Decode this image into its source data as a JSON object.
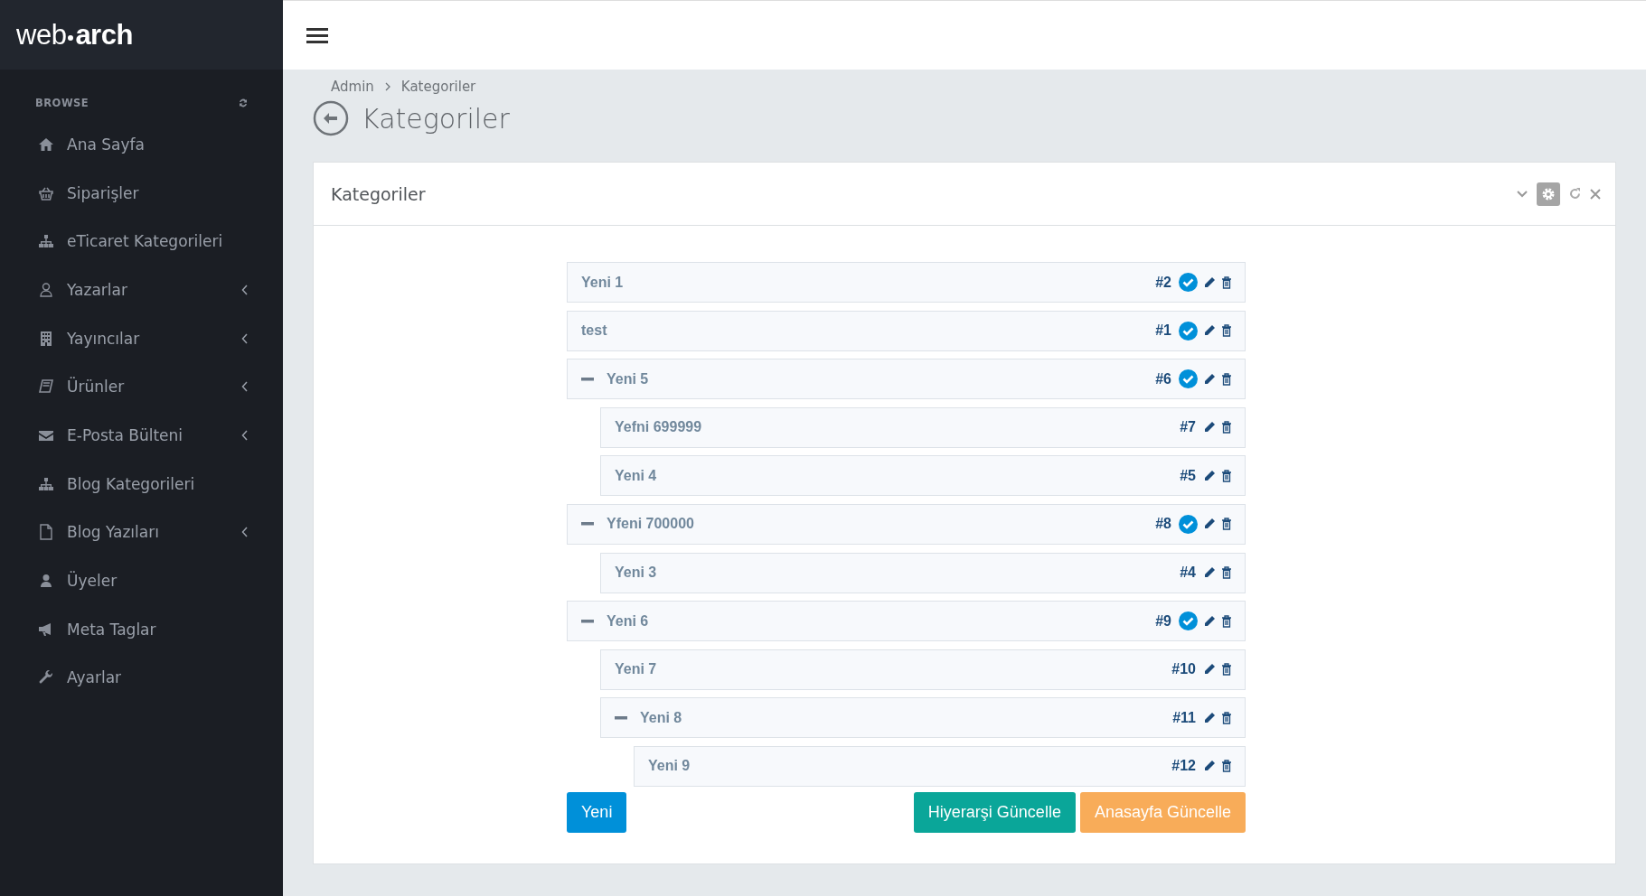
{
  "logo": {
    "light": "web",
    "bold": "arch"
  },
  "sidebar": {
    "section": "BROWSE",
    "items": [
      {
        "label": "Ana Sayfa",
        "submenu": false
      },
      {
        "label": "Siparişler",
        "submenu": false
      },
      {
        "label": "eTicaret Kategorileri",
        "submenu": false
      },
      {
        "label": "Yazarlar",
        "submenu": true
      },
      {
        "label": "Yayıncılar",
        "submenu": true
      },
      {
        "label": "Ürünler",
        "submenu": true
      },
      {
        "label": "E-Posta Bülteni",
        "submenu": true
      },
      {
        "label": "Blog Kategorileri",
        "submenu": false
      },
      {
        "label": "Blog Yazıları",
        "submenu": true
      },
      {
        "label": "Üyeler",
        "submenu": false
      },
      {
        "label": "Meta Taglar",
        "submenu": false
      },
      {
        "label": "Ayarlar",
        "submenu": false
      }
    ]
  },
  "breadcrumb": [
    "Admin",
    "Kategoriler"
  ],
  "page_title": "Kategoriler",
  "card": {
    "title": "Kategoriler"
  },
  "tree": [
    {
      "label": "Yeni 1",
      "id": "#2",
      "verified": true
    },
    {
      "label": "test",
      "id": "#1",
      "verified": true
    },
    {
      "label": "Yeni 5",
      "id": "#6",
      "verified": true,
      "expanded": true,
      "children": [
        {
          "label": "Yefni 699999",
          "id": "#7",
          "verified": false
        },
        {
          "label": "Yeni 4",
          "id": "#5",
          "verified": false
        }
      ]
    },
    {
      "label": "Yfeni 700000",
      "id": "#8",
      "verified": true,
      "expanded": true,
      "children": [
        {
          "label": "Yeni 3",
          "id": "#4",
          "verified": false
        }
      ]
    },
    {
      "label": "Yeni 6",
      "id": "#9",
      "verified": true,
      "expanded": true,
      "children": [
        {
          "label": "Yeni 7",
          "id": "#10",
          "verified": false
        },
        {
          "label": "Yeni 8",
          "id": "#11",
          "verified": false,
          "expanded": true,
          "children": [
            {
              "label": "Yeni 9",
              "id": "#12",
              "verified": false
            }
          ]
        }
      ]
    }
  ],
  "buttons": {
    "new": "Yeni",
    "hierarchy": "Hiyerarşi Güncelle",
    "homepage": "Anasayfa Güncelle"
  }
}
